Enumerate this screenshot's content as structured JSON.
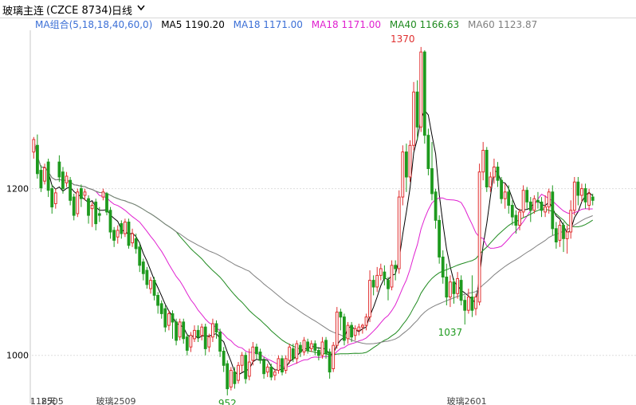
{
  "header": {
    "symbol": "玻璃主连",
    "code": "(CZCE 8734)",
    "period": "日线"
  },
  "legend": {
    "group_label": "MA组合(5,18,18,40,60,0)",
    "items": [
      {
        "label": "MA5 1190.20",
        "color": "#000000"
      },
      {
        "label": "MA18 1171.00",
        "color": "#3b6fd6"
      },
      {
        "label": "MA18 1171.00",
        "color": "#e020d0"
      },
      {
        "label": "MA40 1166.63",
        "color": "#1f8a1f"
      },
      {
        "label": "MA60 1123.87",
        "color": "#808080"
      }
    ],
    "group_color": "#3b6fd6"
  },
  "colors": {
    "up": "#e03030",
    "down": "#1e9a1e",
    "grid": "#dddddd",
    "text": "#000000"
  },
  "chart_data": {
    "type": "candlestick",
    "ylim": [
      950,
      1390
    ],
    "y_ticks": [
      1000,
      1200
    ],
    "x_labels": [
      {
        "index": 0,
        "text": "118天"
      },
      {
        "index": 3,
        "text": "2505"
      },
      {
        "index": 18,
        "text": "玻璃2509"
      },
      {
        "index": 114,
        "text": "玻璃2601"
      }
    ],
    "annotations": [
      {
        "index": 101,
        "value": 1370,
        "text": "1370",
        "where": "above",
        "color": "#e03030"
      },
      {
        "index": 114,
        "value": 1037,
        "text": "1037",
        "where": "below",
        "color": "#1e9a1e"
      },
      {
        "index": 53,
        "value": 952,
        "text": "952",
        "where": "below",
        "color": "#1e9a1e"
      }
    ],
    "candles": [
      [
        1244,
        1259,
        1236,
        1262
      ],
      [
        1252,
        1218,
        1212,
        1265
      ],
      [
        1222,
        1201,
        1196,
        1228
      ],
      [
        1209,
        1225,
        1205,
        1230
      ],
      [
        1232,
        1198,
        1190,
        1236
      ],
      [
        1200,
        1178,
        1170,
        1205
      ],
      [
        1182,
        1195,
        1176,
        1200
      ],
      [
        1232,
        1214,
        1208,
        1240
      ],
      [
        1220,
        1200,
        1194,
        1226
      ],
      [
        1207,
        1215,
        1202,
        1220
      ],
      [
        1210,
        1186,
        1180,
        1214
      ],
      [
        1190,
        1168,
        1162,
        1194
      ],
      [
        1170,
        1196,
        1166,
        1200
      ],
      [
        1200,
        1188,
        1178,
        1205
      ],
      [
        1192,
        1196,
        1186,
        1200
      ],
      [
        1188,
        1168,
        1158,
        1192
      ],
      [
        1176,
        1180,
        1154,
        1184
      ],
      [
        1184,
        1158,
        1150,
        1188
      ],
      [
        1170,
        1168,
        1160,
        1178
      ],
      [
        1190,
        1196,
        1186,
        1200
      ],
      [
        1194,
        1172,
        1168,
        1196
      ],
      [
        1174,
        1148,
        1140,
        1178
      ],
      [
        1150,
        1138,
        1130,
        1154
      ],
      [
        1142,
        1150,
        1134,
        1156
      ],
      [
        1158,
        1146,
        1140,
        1162
      ],
      [
        1146,
        1160,
        1142,
        1164
      ],
      [
        1160,
        1132,
        1128,
        1164
      ],
      [
        1135,
        1146,
        1130,
        1152
      ],
      [
        1140,
        1128,
        1122,
        1146
      ],
      [
        1130,
        1108,
        1100,
        1134
      ],
      [
        1112,
        1098,
        1090,
        1116
      ],
      [
        1102,
        1085,
        1080,
        1106
      ],
      [
        1080,
        1090,
        1074,
        1094
      ],
      [
        1090,
        1072,
        1066,
        1094
      ],
      [
        1072,
        1060,
        1050,
        1076
      ],
      [
        1062,
        1050,
        1044,
        1066
      ],
      [
        1056,
        1034,
        1028,
        1060
      ],
      [
        1036,
        1050,
        1030,
        1054
      ],
      [
        1050,
        1040,
        1020,
        1054
      ],
      [
        1040,
        1018,
        1012,
        1044
      ],
      [
        1022,
        1040,
        1018,
        1044
      ],
      [
        1040,
        1020,
        1014,
        1044
      ],
      [
        1022,
        1006,
        1000,
        1026
      ],
      [
        1010,
        1024,
        1004,
        1028
      ],
      [
        1020,
        1030,
        1016,
        1036
      ],
      [
        1030,
        1022,
        1016,
        1036
      ],
      [
        1024,
        1034,
        1018,
        1038
      ],
      [
        1034,
        1008,
        1000,
        1038
      ],
      [
        1010,
        1022,
        1004,
        1026
      ],
      [
        1022,
        1038,
        1016,
        1044
      ],
      [
        1038,
        1028,
        1020,
        1042
      ],
      [
        1028,
        1005,
        998,
        1032
      ],
      [
        1005,
        988,
        980,
        1010
      ],
      [
        990,
        960,
        952,
        994
      ],
      [
        962,
        982,
        958,
        986
      ],
      [
        980,
        966,
        960,
        986
      ],
      [
        970,
        988,
        966,
        992
      ],
      [
        988,
        1000,
        980,
        1004
      ],
      [
        1000,
        972,
        966,
        1004
      ],
      [
        975,
        992,
        970,
        1008
      ],
      [
        994,
        1010,
        988,
        1016
      ],
      [
        1010,
        1002,
        996,
        1014
      ],
      [
        1004,
        994,
        990,
        1008
      ],
      [
        994,
        978,
        972,
        998
      ],
      [
        980,
        986,
        974,
        990
      ],
      [
        986,
        974,
        970,
        990
      ],
      [
        976,
        980,
        970,
        984
      ],
      [
        982,
        996,
        978,
        1000
      ],
      [
        996,
        980,
        976,
        1000
      ],
      [
        982,
        996,
        978,
        1000
      ],
      [
        994,
        1010,
        990,
        1014
      ],
      [
        1008,
        996,
        992,
        1014
      ],
      [
        996,
        1014,
        990,
        1018
      ],
      [
        1012,
        1004,
        998,
        1016
      ],
      [
        1004,
        1018,
        1000,
        1022
      ],
      [
        1016,
        1006,
        1002,
        1020
      ],
      [
        1008,
        1014,
        1004,
        1018
      ],
      [
        1014,
        1006,
        1000,
        1018
      ],
      [
        1006,
        1000,
        994,
        1010
      ],
      [
        1000,
        1016,
        996,
        1022
      ],
      [
        1018,
        1002,
        996,
        1022
      ],
      [
        1004,
        980,
        972,
        1008
      ],
      [
        984,
        1012,
        980,
        1016
      ],
      [
        1012,
        1052,
        1008,
        1058
      ],
      [
        1052,
        1046,
        1030,
        1056
      ],
      [
        1046,
        1018,
        1012,
        1050
      ],
      [
        1020,
        1036,
        1014,
        1040
      ],
      [
        1036,
        1022,
        1016,
        1040
      ],
      [
        1024,
        1032,
        1018,
        1036
      ],
      [
        1030,
        1034,
        1024,
        1038
      ],
      [
        1034,
        1036,
        1026,
        1038
      ],
      [
        1036,
        1046,
        1030,
        1050
      ],
      [
        1046,
        1090,
        1040,
        1102
      ],
      [
        1090,
        1082,
        1072,
        1096
      ],
      [
        1082,
        1096,
        1076,
        1106
      ],
      [
        1096,
        1104,
        1090,
        1110
      ],
      [
        1100,
        1092,
        1084,
        1108
      ],
      [
        1090,
        1080,
        1066,
        1094
      ],
      [
        1082,
        1108,
        1078,
        1114
      ],
      [
        1108,
        1104,
        1090,
        1114
      ],
      [
        1104,
        1190,
        1098,
        1198
      ],
      [
        1190,
        1244,
        1180,
        1252
      ],
      [
        1244,
        1214,
        1196,
        1254
      ],
      [
        1214,
        1252,
        1208,
        1258
      ],
      [
        1252,
        1316,
        1246,
        1328
      ],
      [
        1316,
        1274,
        1258,
        1330
      ],
      [
        1274,
        1364,
        1268,
        1370
      ],
      [
        1364,
        1264,
        1254,
        1366
      ],
      [
        1264,
        1224,
        1216,
        1272
      ],
      [
        1224,
        1194,
        1186,
        1256
      ],
      [
        1196,
        1162,
        1152,
        1200
      ],
      [
        1162,
        1118,
        1110,
        1168
      ],
      [
        1118,
        1094,
        1086,
        1126
      ],
      [
        1094,
        1070,
        1060,
        1110
      ],
      [
        1070,
        1088,
        1058,
        1096
      ],
      [
        1088,
        1074,
        1062,
        1092
      ],
      [
        1074,
        1092,
        1068,
        1100
      ],
      [
        1090,
        1066,
        1060,
        1096
      ],
      [
        1066,
        1054,
        1037,
        1072
      ],
      [
        1054,
        1070,
        1050,
        1080
      ],
      [
        1070,
        1054,
        1046,
        1096
      ],
      [
        1056,
        1070,
        1048,
        1074
      ],
      [
        1064,
        1220,
        1060,
        1230
      ],
      [
        1220,
        1246,
        1210,
        1256
      ],
      [
        1246,
        1202,
        1196,
        1250
      ],
      [
        1202,
        1214,
        1196,
        1220
      ],
      [
        1214,
        1226,
        1206,
        1236
      ],
      [
        1226,
        1210,
        1202,
        1232
      ],
      [
        1210,
        1188,
        1182,
        1214
      ],
      [
        1188,
        1196,
        1176,
        1206
      ],
      [
        1196,
        1180,
        1170,
        1204
      ],
      [
        1180,
        1166,
        1156,
        1186
      ],
      [
        1168,
        1156,
        1146,
        1174
      ],
      [
        1156,
        1172,
        1150,
        1176
      ],
      [
        1172,
        1198,
        1166,
        1204
      ],
      [
        1198,
        1184,
        1176,
        1202
      ],
      [
        1184,
        1174,
        1160,
        1190
      ],
      [
        1174,
        1188,
        1170,
        1192
      ],
      [
        1186,
        1184,
        1176,
        1196
      ],
      [
        1184,
        1174,
        1166,
        1190
      ],
      [
        1172,
        1178,
        1166,
        1192
      ],
      [
        1178,
        1196,
        1170,
        1200
      ],
      [
        1196,
        1152,
        1144,
        1204
      ],
      [
        1152,
        1136,
        1128,
        1160
      ],
      [
        1138,
        1156,
        1130,
        1162
      ],
      [
        1156,
        1140,
        1124,
        1160
      ],
      [
        1140,
        1148,
        1122,
        1156
      ],
      [
        1148,
        1174,
        1140,
        1186
      ],
      [
        1174,
        1208,
        1168,
        1214
      ],
      [
        1208,
        1192,
        1180,
        1214
      ],
      [
        1192,
        1200,
        1184,
        1206
      ],
      [
        1200,
        1184,
        1176,
        1206
      ],
      [
        1180,
        1194,
        1174,
        1200
      ],
      [
        1190,
        1186,
        1180,
        1194
      ]
    ]
  }
}
